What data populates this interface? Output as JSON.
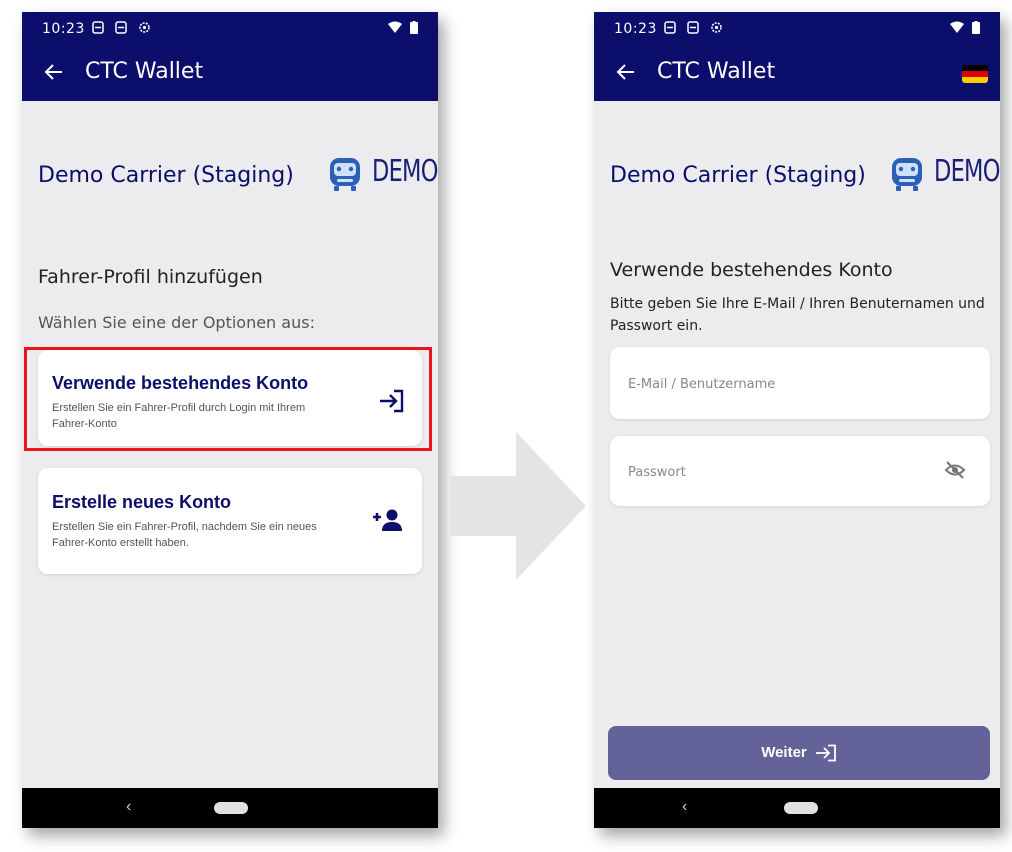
{
  "status_bar": {
    "time": "10:23",
    "icons": [
      "sim-icon",
      "sim-icon",
      "settings-icon",
      "wifi-icon",
      "battery-icon"
    ]
  },
  "app": {
    "title": "CTC Wallet"
  },
  "carrier": {
    "name": "Demo Carrier (Staging)",
    "logo_text": "DEMO"
  },
  "left_screen": {
    "heading": "Fahrer-Profil hinzufügen",
    "instruction": "Wählen Sie eine der Optionen aus:",
    "options": [
      {
        "title": "Verwende bestehendes Konto",
        "subtitle": "Erstellen Sie ein Fahrer-Profil durch Login mit Ihrem Fahrer-Konto",
        "icon": "login-icon"
      },
      {
        "title": "Erstelle neues Konto",
        "subtitle": "Erstellen Sie ein Fahrer-Profil, nachdem Sie ein neues Fahrer-Konto erstellt haben.",
        "icon": "add-person-icon"
      }
    ]
  },
  "right_screen": {
    "heading": "Verwende bestehendes Konto",
    "instruction": "Bitte geben Sie Ihre E-Mail / Ihren Benuternamen und Passwort ein.",
    "email_placeholder": "E-Mail / Benutzername",
    "password_placeholder": "Passwort",
    "submit_label": "Weiter",
    "language_flag": "de-flag"
  },
  "colors": {
    "primary": "#0b0e6b",
    "highlight": "#e8141a",
    "button": "#636399",
    "background": "#ececef"
  }
}
